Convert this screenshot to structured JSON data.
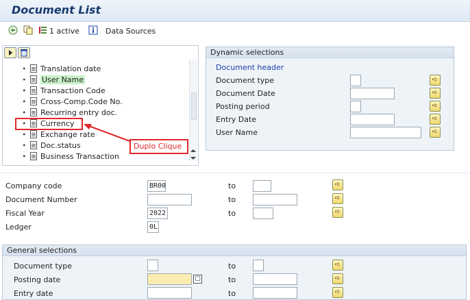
{
  "window": {
    "title": "Document List"
  },
  "toolbar": {
    "active_label": "1 active",
    "data_sources_label": "Data Sources"
  },
  "tree": {
    "items": [
      {
        "label": "Translation date"
      },
      {
        "label": "User Name"
      },
      {
        "label": "Transaction Code"
      },
      {
        "label": "Cross-Comp.Code No."
      },
      {
        "label": "Recurring entry doc."
      },
      {
        "label": "Currency"
      },
      {
        "label": "Exchange rate"
      },
      {
        "label": "Doc.status"
      },
      {
        "label": "Business Transaction"
      }
    ]
  },
  "annotation": {
    "label": "Duplo Clique",
    "color": "#e3262b"
  },
  "dynamic_selections": {
    "title": "Dynamic selections",
    "group": "Document header",
    "fields": [
      {
        "label": "Document type",
        "value": ""
      },
      {
        "label": "Document Date",
        "value": ""
      },
      {
        "label": "Posting period",
        "value": ""
      },
      {
        "label": "Entry Date",
        "value": ""
      },
      {
        "label": "User Name",
        "value": ""
      }
    ]
  },
  "main": {
    "to_label": "to",
    "fields": [
      {
        "label": "Company code",
        "value": "BR00"
      },
      {
        "label": "Document Number",
        "value": ""
      },
      {
        "label": "Fiscal Year",
        "value": "2022"
      },
      {
        "label": "Ledger",
        "value": "0L"
      }
    ]
  },
  "general": {
    "title": "General selections",
    "fields": [
      {
        "label": "Document type",
        "value": ""
      },
      {
        "label": "Posting date",
        "value": ""
      },
      {
        "label": "Entry date",
        "value": ""
      }
    ]
  }
}
